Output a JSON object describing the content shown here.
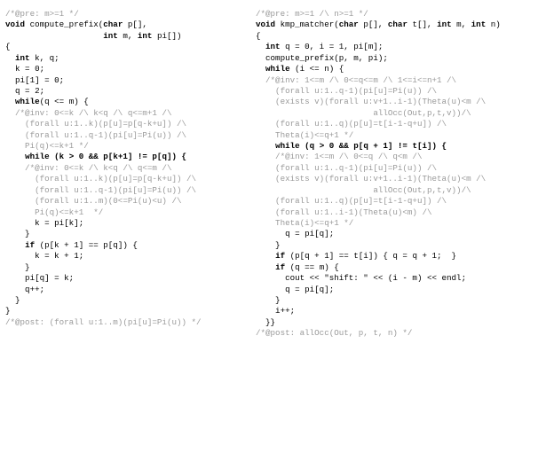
{
  "left": {
    "l01": "/*@pre: m>=1 */",
    "l02a": "void",
    "l02b": " compute_prefix(",
    "l02c": "char",
    "l02d": " p[],",
    "l03a": "                    ",
    "l03b": "int",
    "l03c": " m, ",
    "l03d": "int",
    "l03e": " pi[])",
    "l04": "{",
    "l05a": "  ",
    "l05b": "int",
    "l05c": " k, q;",
    "l06": "  k = 0;",
    "l07": "  pi[1] = 0;",
    "l08": "  q = 2;",
    "l09a": "  ",
    "l09b": "while",
    "l09c": "(q <= m) {",
    "l10": "  /*@inv: 0<=k /\\ k<q /\\ q<=m+1 /\\",
    "l11": "    (forall u:1..k)(p[u]=p[q-k+u]) /\\",
    "l12": "    (forall u:1..q-1)(pi[u]=Pi(u)) /\\",
    "l13": "    Pi(q)<=k+1 */",
    "l14a": "    ",
    "l14b": "while",
    "l14c": " (k > 0 && p[k+1] != p[q]) {",
    "l15": "    /*@inv: 0<=k /\\ k<q /\\ q<=m /\\",
    "l16": "      (forall u:1..k)(p[u]=p[q-k+u]) /\\",
    "l17": "      (forall u:1..q-1)(pi[u]=Pi(u)) /\\",
    "l18": "      (forall u:1..m)(0<=Pi(u)<u) /\\",
    "l19": "      Pi(q)<=k+1  */",
    "l20": "      k = pi[k];",
    "l21": "    }",
    "l22a": "    ",
    "l22b": "if",
    "l22c": " (p[k + 1] == p[q]) {",
    "l23": "      k = k + 1;",
    "l24": "    }",
    "l25": "    pi[q] = k;",
    "l26": "    q++;",
    "l27": "  }",
    "l28": "}",
    "l29": "/*@post: (forall u:1..m)(pi[u]=Pi(u)) */"
  },
  "right": {
    "r01": "/*@pre: m>=1 /\\ n>=1 */",
    "r02a": "void",
    "r02b": " kmp_matcher(",
    "r02c": "char",
    "r02d": " p[], ",
    "r02e": "char",
    "r02f": " t[], ",
    "r02g": "int",
    "r02h": " m, ",
    "r02i": "int",
    "r02j": " n)",
    "r03": "{",
    "r04a": "  ",
    "r04b": "int",
    "r04c": " q = 0, i = 1, pi[m];",
    "r05": "  compute_prefix(p, m, pi);",
    "r06a": "  ",
    "r06b": "while",
    "r06c": " (i <= n) {",
    "r07": "  /*@inv: 1<=m /\\ 0<=q<=m /\\ 1<=i<=n+1 /\\",
    "r08": "    (forall u:1..q-1)(pi[u]=Pi(u)) /\\",
    "r09": "    (exists v)(forall u:v+1..i-1)(Theta(u)<m /\\",
    "r10": "                        allOcc(Out,p,t,v))/\\",
    "r11": "    (forall u:1..q)(p[u]=t[i-1-q+u]) /\\",
    "r12": "    Theta(i)<=q+1 */",
    "r13a": "    ",
    "r13b": "while",
    "r13c": " (q > 0 && p[q + 1] != t[i]) {",
    "r14": "    /*@inv: 1<=m /\\ 0<=q /\\ q<m /\\",
    "r15": "    (forall u:1..q-1)(pi[u]=Pi(u)) /\\",
    "r16": "    (exists v)(forall u:v+1..i-1)(Theta(u)<m /\\",
    "r17": "                        allOcc(Out,p,t,v))/\\",
    "r18": "    (forall u:1..q)(p[u]=t[i-1-q+u]) /\\",
    "r19": "    (forall u:1..i-1)(Theta(u)<m) /\\",
    "r20": "    Theta(i)<=q+1 */",
    "r21": "      q = pi[q];",
    "r22": "    }",
    "r23a": "    ",
    "r23b": "if",
    "r23c": " (p[q + 1] == t[i]) { q = q + 1;  }",
    "r24a": "    ",
    "r24b": "if",
    "r24c": " (q == m) {",
    "r25": "      cout << \"shift: \" << (i - m) << endl;",
    "r26": "      q = pi[q];",
    "r27": "    }",
    "r28": "    i++;",
    "r29": "  }}",
    "r30": "/*@post: allOcc(Out, p, t, n) */"
  }
}
